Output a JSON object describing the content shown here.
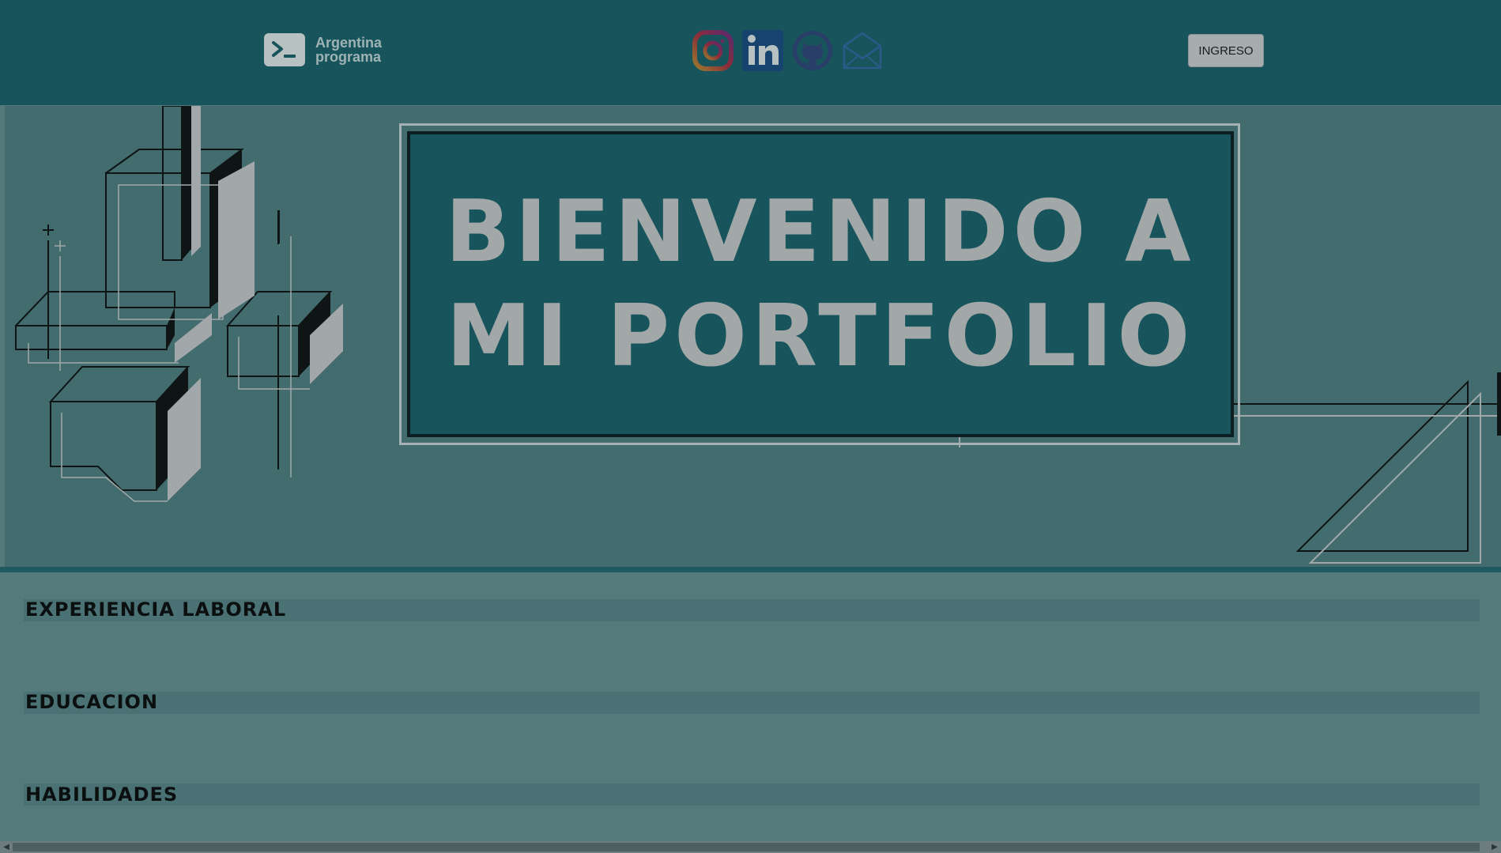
{
  "header": {
    "logo": {
      "line1": "Argentina",
      "line2": "programa",
      "icon": "terminal-prompt-icon"
    },
    "social": [
      {
        "name": "instagram",
        "icon": "instagram-icon"
      },
      {
        "name": "linkedin",
        "icon": "linkedin-icon"
      },
      {
        "name": "github",
        "icon": "github-icon"
      },
      {
        "name": "email",
        "icon": "envelope-icon"
      }
    ],
    "login_label": "INGRESO"
  },
  "banner": {
    "line1": "BIENVENIDO A",
    "line2": "MI PORTFOLIO"
  },
  "sections": {
    "experience": "EXPERIENCIA LABORAL",
    "education": "EDUCACION",
    "skills": "HABILIDADES"
  },
  "colors": {
    "header_bg": "#18545b",
    "banner_bg": "#436c6f",
    "page_bg": "#557a7c",
    "section_bar": "#4a7274"
  }
}
